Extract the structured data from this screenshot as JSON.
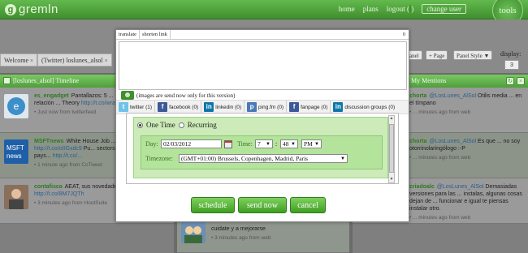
{
  "app": {
    "logo": "gremln",
    "logo_mark": "g"
  },
  "topnav": {
    "home": "home",
    "plans": "plans",
    "logout": "logout (",
    "logout_user": "        ",
    "logout_end": ")",
    "change_user": "change user",
    "tools": "tools"
  },
  "tabs": [
    {
      "label": "Welcome"
    },
    {
      "label": "(Twitter) loslunes_alsol"
    }
  ],
  "toolbar": {
    "panel": "anel",
    "page": "+ Page",
    "panel_style": "Panel Style ▼",
    "display_label": "display:",
    "display_value": "3"
  },
  "columns": {
    "left": {
      "title": "[loslunes_alsol] Timeline",
      "tweets": [
        {
          "user": "es_engadget",
          "text": "Pantallazos: 5 ... mantienen una idílica relación ... Theory ",
          "link": "http://t.co/wraeR3H6ibF",
          "meta": "• Just now from twitterfeed"
        },
        {
          "user": "MSFTnews",
          "text": "White House Job ... Seattle ",
          "link": "http://t.co/o0Gxdc9",
          "text2": " Pu... sectors know #highered pays... ",
          "link2": "http://t.co/...",
          "meta": "• 1 minute ago from CoTweet"
        },
        {
          "user": "contafisca",
          "text": "AEAT, sus novedades y cómo solventarlas ",
          "link": "http://t.co/8M7JQTh",
          "meta": "• 3 minutes ago from HootSuite"
        }
      ]
    },
    "middle": {
      "text": "cuidate y a mejorarse",
      "meta": "• 3 minutes ago from web"
    },
    "right": {
      "title": "My Mentions",
      "tweets": [
        {
          "user": "chorta",
          "handle": "@LosLunes_AlSol",
          "text": " Otilis media ... en el tímpano",
          "meta": "• ... minutes ago from web"
        },
        {
          "user": "chorta",
          "handle": "@LosLunes_AlSol",
          "text": " Es que ... no soy otorrinolaringólogo :-P",
          "meta": "• ... minutes ago from web"
        },
        {
          "user": "criadoalc",
          "handle": "@LosLunes_AlSol",
          "text": " Demasiadas versiones para las ... instalas, algunas cosas dejan de ... funcionar e igual te piensas instalar otro.",
          "meta": "• ... minutes ago from web"
        }
      ]
    }
  },
  "modal": {
    "tabs": {
      "translate": "translate",
      "shorten_link": "shorten link"
    },
    "char_count": "0",
    "networks": [
      {
        "icon": "t",
        "label": "twitter (1)"
      },
      {
        "icon": "f",
        "label": "facebook (0)"
      },
      {
        "icon": "in",
        "label": "linkedin (0)"
      },
      {
        "icon": "p",
        "label": "ping.fm (0)"
      },
      {
        "icon": "f",
        "label": "fanpage (0)"
      },
      {
        "icon": "in",
        "label": "discussion groups (0)"
      }
    ],
    "image_note": "(images are send now only for this version)",
    "schedule": {
      "one_time": "One Time",
      "recurring": "Recurring",
      "day_label": "Day:",
      "day_value": "02/03/2012",
      "time_label": "Time:",
      "hour": "7",
      "minute": "48",
      "ampm": "PM",
      "timezone_label": "Timezone:",
      "timezone_value": "(GMT+01:00) Brussels, Copenhagen, Madrid, Paris"
    },
    "buttons": {
      "schedule": "schedule",
      "send_now": "send now",
      "cancel": "cancel"
    }
  }
}
